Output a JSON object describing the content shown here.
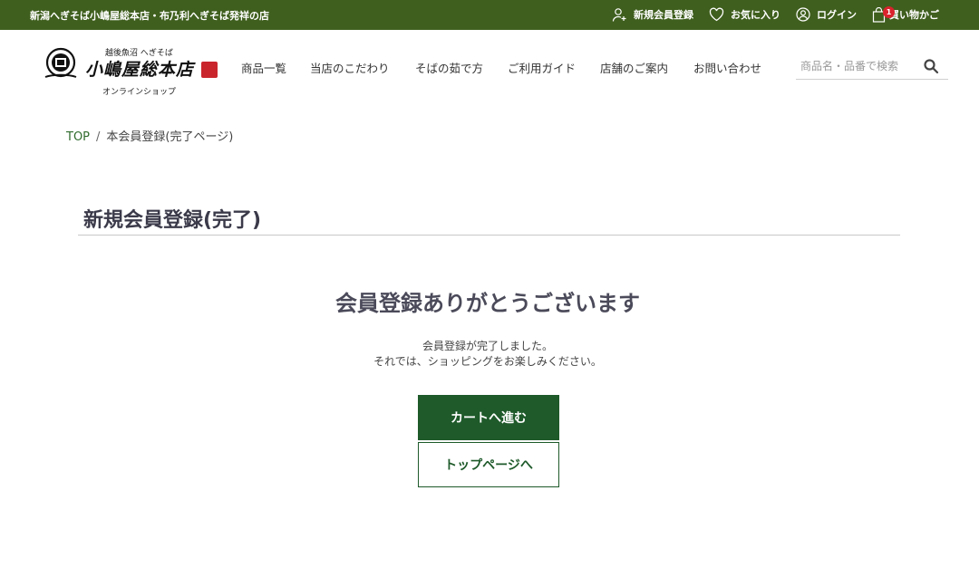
{
  "topbar": {
    "tagline": "新潟へぎそば小嶋屋総本店・布乃利へぎそば発祥の店",
    "register": "新規会員登録",
    "favorites": "お気に入り",
    "login": "ログイン",
    "cart": "買い物かご",
    "cart_count": "1"
  },
  "logo": {
    "catch": "越後魚沼 へぎそば",
    "name": "小嶋屋総本店",
    "sub": "オンラインショップ"
  },
  "nav": {
    "items": [
      "商品一覧",
      "当店のこだわり",
      "そばの茹で方",
      "ご利用ガイド",
      "店舗のご案内",
      "お問い合わせ"
    ]
  },
  "search": {
    "placeholder": "商品名・品番で検索"
  },
  "breadcrumb": {
    "top": "TOP",
    "separator": "/",
    "current": "本会員登録(完了ページ)"
  },
  "page": {
    "title": "新規会員登録(完了)",
    "thanks": "会員登録ありがとうございます",
    "message_line1": "会員登録が完了しました。",
    "message_line2": "それでは、ショッピングをお楽しみください。",
    "cart_button": "カートへ進む",
    "top_button": "トップページへ"
  },
  "colors": {
    "topbar": "#3f5f1e",
    "primary_button": "#1e5a2a",
    "badge": "#d9232d"
  }
}
